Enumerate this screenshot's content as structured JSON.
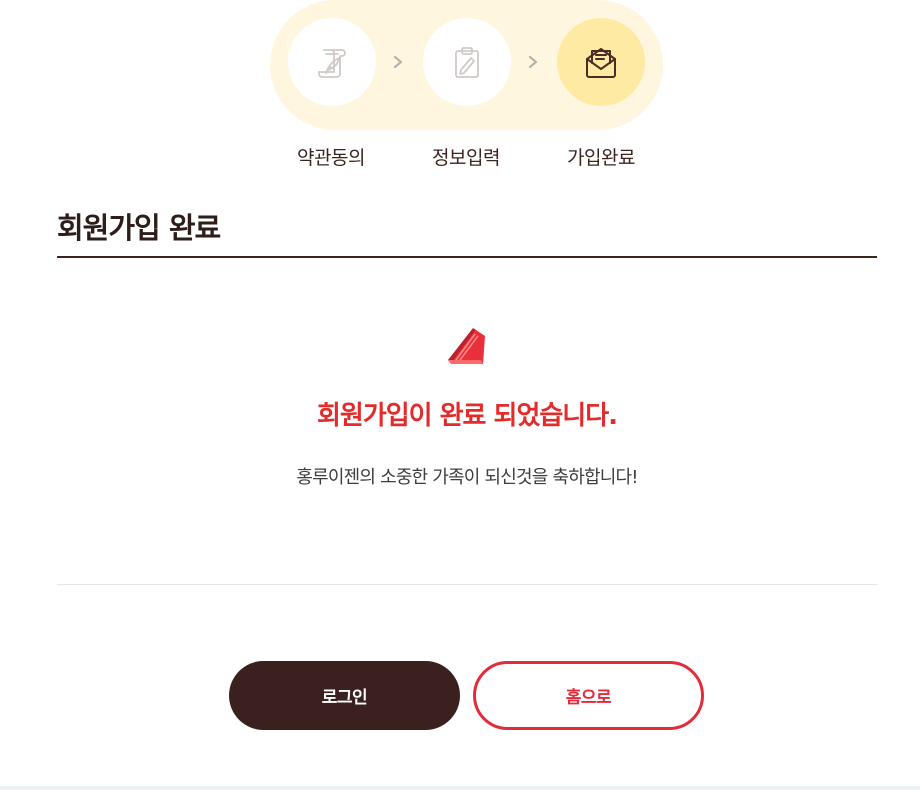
{
  "steps": [
    {
      "label": "약관동의",
      "icon": "scroll-quill-icon",
      "active": false
    },
    {
      "label": "정보입력",
      "icon": "clipboard-pen-icon",
      "active": false
    },
    {
      "label": "가입완료",
      "icon": "envelope-letter-icon",
      "active": true
    }
  ],
  "step_separator_icon": "chevron-right-icon",
  "section": {
    "title": "회원가입 완료"
  },
  "result": {
    "icon": "red-cake-slice-icon",
    "headline": "회원가입이 완료 되었습니다.",
    "message": "홍루이젠의 소중한 가족이 되신것을 축하합니다!"
  },
  "buttons": {
    "login_label": "로그인",
    "home_label": "홈으로"
  },
  "colors": {
    "brand_brown": "#3b2020",
    "accent_red": "#e32b2b",
    "step_pill_bg": "#fff6df",
    "active_step_bg": "#ffeaa4"
  }
}
